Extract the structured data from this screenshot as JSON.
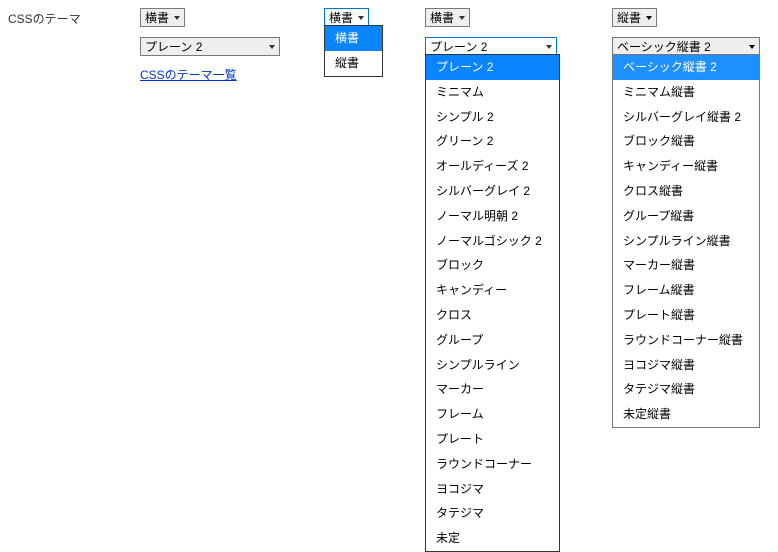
{
  "label": "CSSのテーマ",
  "link": "CSSのテーマ一覧",
  "col1": {
    "orientSelect": "横書",
    "themeSelect": "プレーン 2"
  },
  "col2": {
    "orientSelect": "横書",
    "options": [
      "横書",
      "縦書"
    ],
    "selected": "横書"
  },
  "col3": {
    "orientSelect": "横書",
    "themeSelect": "プレーン 2",
    "options": [
      "プレーン 2",
      "ミニマム",
      "シンプル 2",
      "グリーン 2",
      "オールディーズ 2",
      "シルバーグレイ 2",
      "ノーマル明朝 2",
      "ノーマルゴシック 2",
      "ブロック",
      "キャンディー",
      "クロス",
      "グループ",
      "シンプルライン",
      "マーカー",
      "フレーム",
      "プレート",
      "ラウンドコーナー",
      "ヨコジマ",
      "タテジマ",
      "未定"
    ],
    "selected": "プレーン 2"
  },
  "col4": {
    "orientSelect": "縦書",
    "themeSelect": "ベーシック縦書 2",
    "options": [
      "ベーシック縦書 2",
      "ミニマム縦書",
      "シルバーグレイ縦書 2",
      "ブロック縦書",
      "キャンディー縦書",
      "クロス縦書",
      "グループ縦書",
      "シンプルライン縦書",
      "マーカー縦書",
      "フレーム縦書",
      "プレート縦書",
      "ラウンドコーナー縦書",
      "ヨコジマ縦書",
      "タテジマ縦書",
      "未定縦書"
    ],
    "selected": "ベーシック縦書 2"
  }
}
